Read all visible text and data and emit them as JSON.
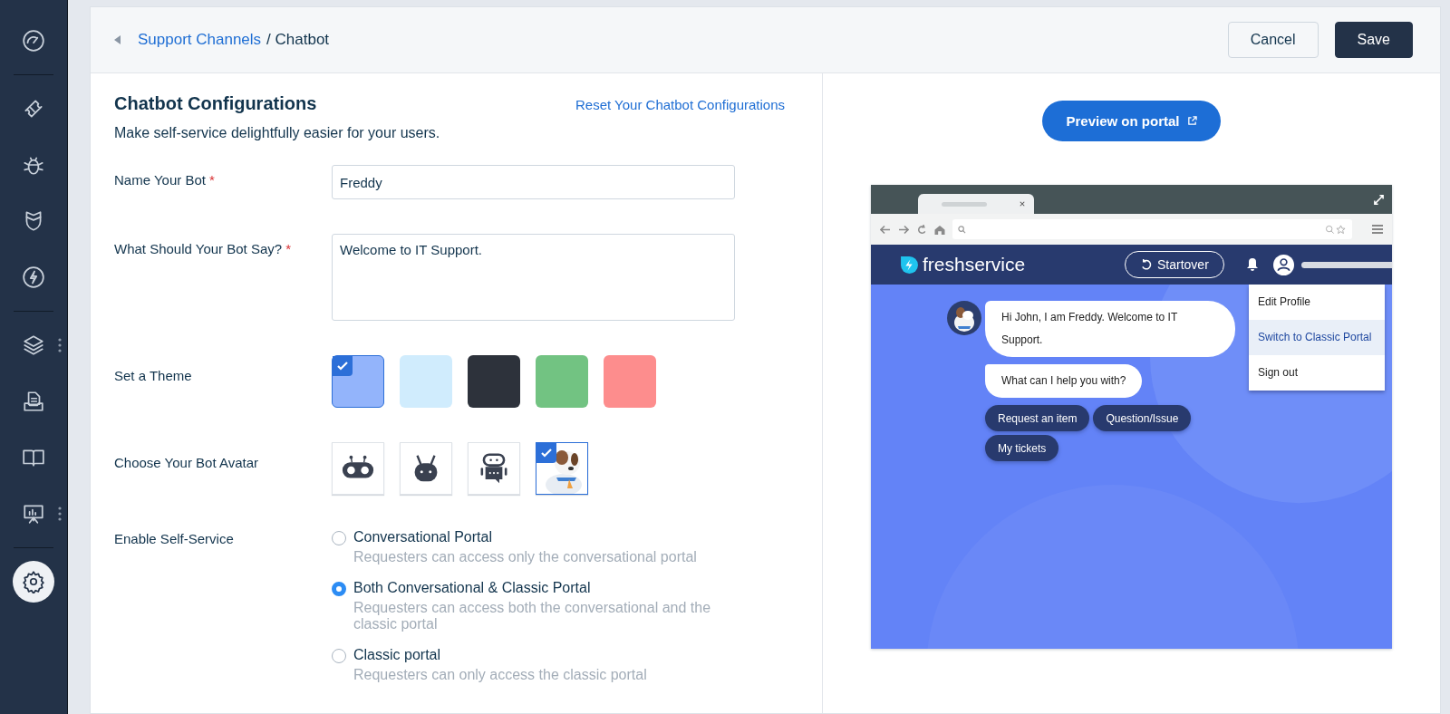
{
  "sidebar": {
    "groups": [
      {
        "items": [
          {
            "kind": "gauge",
            "selected": false,
            "more": false
          }
        ]
      },
      {
        "items": [
          {
            "kind": "ticket",
            "selected": false,
            "more": false
          },
          {
            "kind": "bug",
            "selected": false,
            "more": false
          },
          {
            "kind": "shield",
            "selected": false,
            "more": false
          },
          {
            "kind": "bolt",
            "selected": false,
            "more": false
          }
        ]
      },
      {
        "items": [
          {
            "kind": "layers",
            "selected": false,
            "more": true
          },
          {
            "kind": "document",
            "selected": false,
            "more": false
          },
          {
            "kind": "book",
            "selected": false,
            "more": false
          },
          {
            "kind": "presentation",
            "selected": false,
            "more": true
          }
        ]
      },
      {
        "items": [
          {
            "kind": "gear",
            "selected": true,
            "more": false
          }
        ]
      }
    ]
  },
  "header": {
    "breadcrumb": {
      "link": "Support Channels",
      "current": "/ Chatbot"
    },
    "buttons": [
      {
        "label": "Cancel",
        "kind": "secondary"
      },
      {
        "label": "Save",
        "kind": "primary"
      }
    ]
  },
  "form": {
    "title": "Chatbot Configurations",
    "reset_link": "Reset Your Chatbot Configurations",
    "subtitle": "Make self-service delightfully easier for your users.",
    "name": {
      "label": "Name Your Bot",
      "required": true,
      "required_mark": "*",
      "value": "Freddy"
    },
    "message": {
      "label": "What Should Your Bot Say?",
      "required": true,
      "required_mark": "*",
      "value": "Welcome to IT Support."
    },
    "theme": {
      "label": "Set a Theme",
      "swatches": [
        {
          "color": "#93b4fb",
          "selected": true
        },
        {
          "color": "#d0ecfd",
          "selected": false
        },
        {
          "color": "#2d323b",
          "selected": false
        },
        {
          "color": "#72c382",
          "selected": false
        },
        {
          "color": "#fd8d8d",
          "selected": false
        }
      ]
    },
    "avatar": {
      "label": "Choose Your Bot Avatar",
      "options": [
        {
          "kind": "robot-wide",
          "selected": false
        },
        {
          "kind": "robot-antenna",
          "selected": false
        },
        {
          "kind": "robot-chat",
          "selected": false
        },
        {
          "kind": "picture",
          "selected": true
        }
      ]
    },
    "self_service": {
      "label": "Enable Self-Service",
      "options": [
        {
          "label": "Conversational Portal",
          "description": "Requesters can access only the conversational portal",
          "selected": false
        },
        {
          "label": "Both Conversational & Classic Portal",
          "description": "Requesters can access both the conversational and the classic portal",
          "selected": true
        },
        {
          "label": "Classic portal",
          "description": "Requesters can only access the classic portal",
          "selected": false
        }
      ]
    }
  },
  "preview": {
    "button": "Preview on portal",
    "portal": {
      "logo": "freshservice",
      "startover": "Startover",
      "menu": [
        {
          "label": "Edit Profile",
          "selected": false
        },
        {
          "label": "Switch to Classic Portal",
          "selected": true
        },
        {
          "label": "Sign out",
          "selected": false
        }
      ],
      "messages": [
        "Hi John, I am Freddy. Welcome to IT Support.",
        "What can I help you with?"
      ],
      "quick_replies": [
        "Request an item",
        "Question/Issue",
        "My tickets"
      ]
    }
  }
}
